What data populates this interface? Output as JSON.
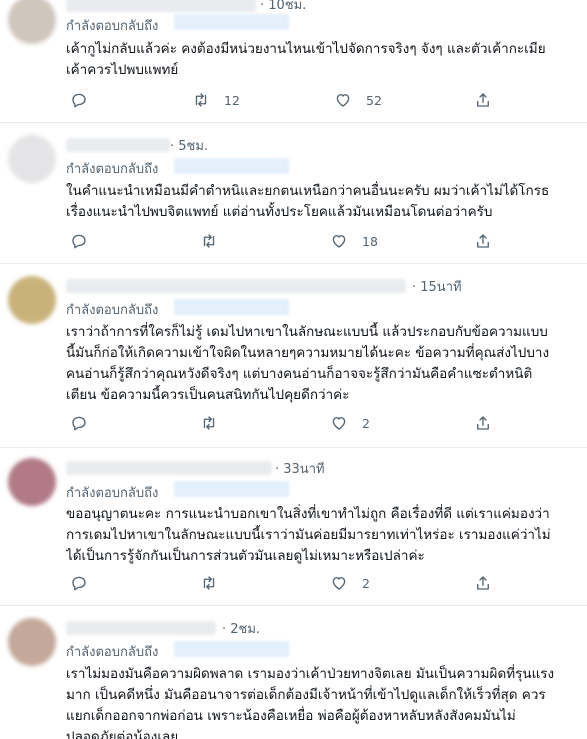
{
  "tweets": [
    {
      "time": "· 10ชม.",
      "reply_prefix": "กำลังตอบกลับถึง",
      "lines": [
        "เค้ากูไม่กลับแล้วค่ะ คงต้องมีหน่วยงานไหนเข้าไปจัดการจริงๆ จังๆ และตัวเค้ากะเมีย",
        "เค้าควรไปพบแพทย์"
      ],
      "retweets": "12",
      "likes": "52"
    },
    {
      "time": "· 5ชม.",
      "reply_prefix": "กำลังตอบกลับถึง",
      "lines": [
        "ในคำแนะนำเหมือนมีคำตำหนิและยกตนเหนือกว่าคนอื่นนะครับ ผมว่าเค้าไม่ได้โกรธ",
        "เรื่องแนะนำไปพบจิตแพทย์ แต่อ่านทั้งประโยคแล้วมันเหมือนโดนต่อว่าครับ"
      ],
      "retweets": "",
      "likes": "18"
    },
    {
      "time": "· 15นาที",
      "reply_prefix": "กำลังตอบกลับถึง",
      "lines": [
        "เราว่าถ้าการที่ใครก็ไม่รู้ เดมไปหาเขาในลักษณะแบบนี้ แล้วประกอบกับข้อความแบบ",
        "นี้มันก็ก่อให้เกิดความเข้าใจผิดในหลายๆความหมายได้นะคะ ข้อความที่คุณส่งไปบาง",
        "คนอ่านก็รู้สึกว่าคุณหวังดีจริงๆ แต่บางคนอ่านก็อาจจะรู้สึกว่ามันคือคำแซะตำหนิติ",
        "เตียน ข้อความนี้ควรเป็นคนสนิทกันไปคุยดีกว่าค่ะ"
      ],
      "retweets": "",
      "likes": "2"
    },
    {
      "time": "· 33นาที",
      "reply_prefix": "กำลังตอบกลับถึง",
      "lines": [
        "ขออนุญาตนะคะ การแนะนำบอกเขาในสิ่งที่เขาทำไม่ถูก คือเรื่องที่ดี แต่เราแค่มองว่า",
        "การเดมไปหาเขาในลักษณะแบบนี้เราว่ามันค่อยมีมารยาทเท่าไหร่อะ เรามองแค่ว่าไม่",
        "ได้เป็นการรู้จักกันเป็นการส่วนตัวมันเลยดูไม่เหมาะหรือเปล่าค่ะ"
      ],
      "retweets": "",
      "likes": "2"
    },
    {
      "time": "· 2ชม.",
      "reply_prefix": "กำลังตอบกลับถึง",
      "lines": [
        "เราไม่มองมันคือความผิดพลาด เรามองว่าเค้าป่วยทางจิตเลย มันเป็นความผิดที่รุนแรง",
        "มาก เป็นคดีหนึ่ง มันคืออนาจารต่อเด็กต้องมีเจ้าหน้าที่เข้าไปดูแลเด็กให้เร็วที่สุด ควร",
        "แยกเด็กออกจากพ่อก่อน เพราะน้องคือเหยื่อ พ่อคือผู้ต้องหาหลับหลังสังคมมันไม่",
        "ปลอดภัยต่อน้องเลย"
      ],
      "retweets": "",
      "likes": ""
    }
  ]
}
